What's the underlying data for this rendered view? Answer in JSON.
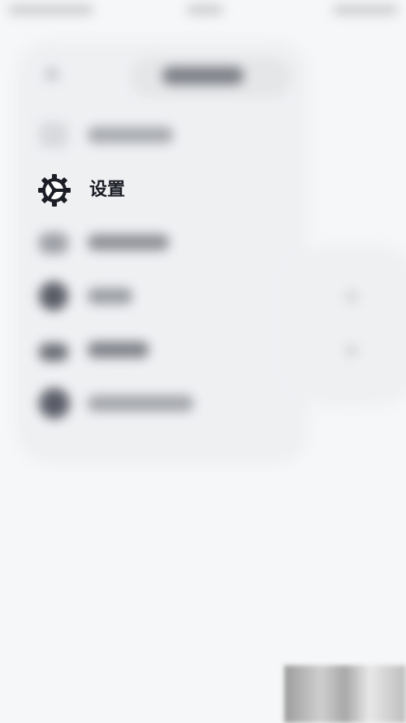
{
  "menu": {
    "focused_item": {
      "label": "设置",
      "icon": "gear-icon"
    },
    "blurred_items": [
      {
        "icon": "document-icon"
      },
      {
        "icon": "image-icon"
      },
      {
        "icon": "avatar-icon"
      },
      {
        "icon": "folder-icon"
      },
      {
        "icon": "user-circle-icon"
      }
    ]
  },
  "colors": {
    "background": "#f6f7f8",
    "focus_text": "#1c1e26"
  }
}
